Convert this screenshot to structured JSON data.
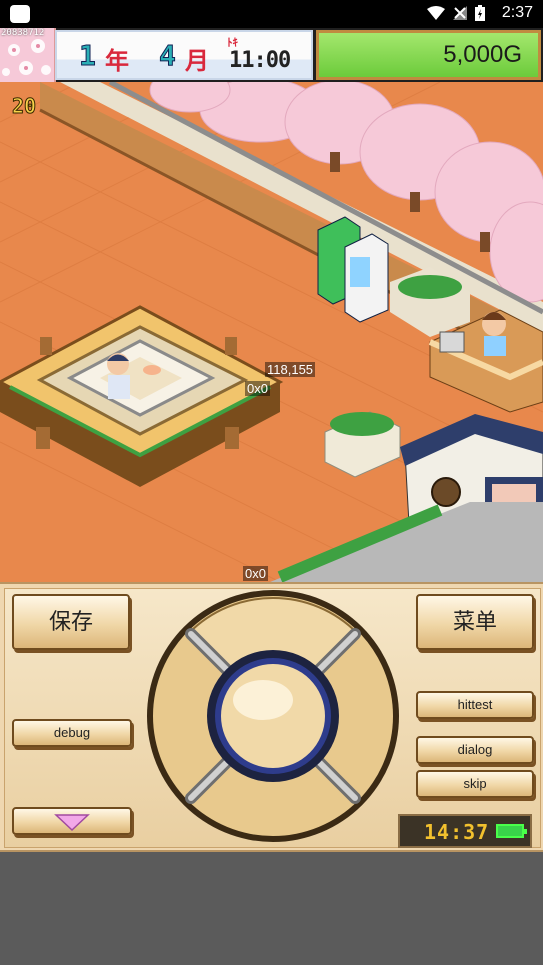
{
  "status_bar": {
    "time": "2:37"
  },
  "hud": {
    "season_code": "20838712",
    "date": {
      "year": "1",
      "year_unit": "年",
      "month": "4",
      "month_unit": "月",
      "tag": "ﾄｷ",
      "time": "11:00"
    },
    "money": "5,000G",
    "floor_count": "20"
  },
  "debug_overlay": {
    "coords": "118,155",
    "label_a": "0x0",
    "label_b": "0x0"
  },
  "controls": {
    "save_label": "保存",
    "menu_label": "菜单",
    "debug_label": "debug",
    "hittest_label": "hittest",
    "dialog_label": "dialog",
    "skip_label": "skip",
    "clock": "14:37"
  },
  "colors": {
    "floor": "#e8884c",
    "money_bg": "#6ccb3b",
    "panel_bg": "#efd7b0",
    "blossom": "#f6c9d8"
  }
}
